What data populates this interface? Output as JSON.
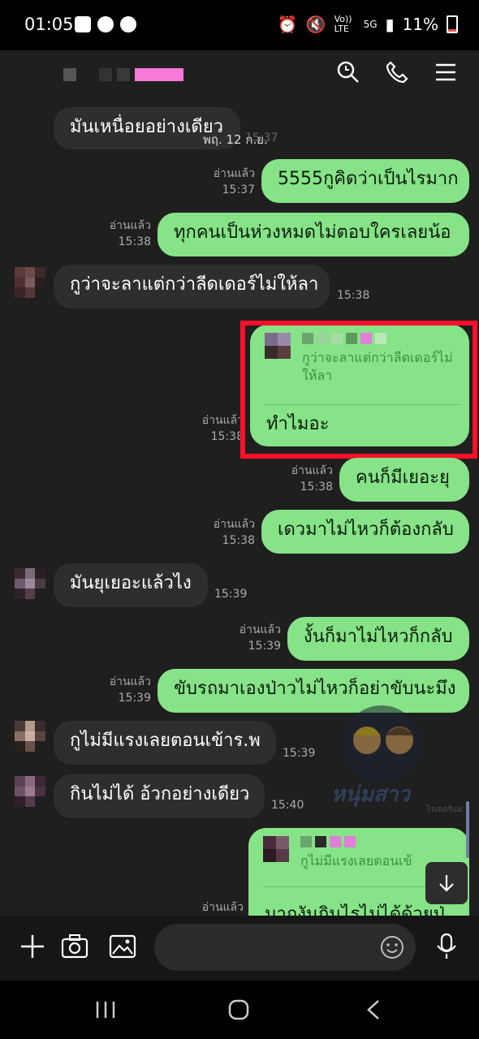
{
  "status_bar": {
    "time": "01:05",
    "network": "Vo)) LTE",
    "network_type": "5G",
    "battery": "11%"
  },
  "header": {
    "icons": [
      "search-icon",
      "phone-icon",
      "menu-icon"
    ]
  },
  "date_chip": "พฤ. 12 ก.ย.",
  "messages": [
    {
      "id": "m1",
      "side": "in",
      "text": "มันเหนื่อยอย่างเดียว",
      "time": "15:37"
    },
    {
      "id": "m2",
      "side": "out",
      "text": "5555กูคิดว่าเป็นไรมาก",
      "read": "อ่านแล้ว",
      "time": "15:37"
    },
    {
      "id": "m3",
      "side": "out",
      "text": "ทุกคนเป็นห่วงหมดไม่ตอบใครเลยน้อ",
      "read": "อ่านแล้ว",
      "time": "15:38"
    },
    {
      "id": "m4",
      "side": "in",
      "text": "กูว่าจะลาแต่กว่าลีดเดอร์ไม่ให้ลา",
      "time": "15:38"
    },
    {
      "id": "m5",
      "side": "out",
      "quote": "กูว่าจะลาแต่กว่าลีดเดอร์ไม่ให้ลา",
      "text": "ทำไมอะ",
      "read": "อ่านแล้ว",
      "time": "15:38"
    },
    {
      "id": "m6",
      "side": "out",
      "text": "คนก็มีเยอะยุ",
      "read": "อ่านแล้ว",
      "time": "15:38"
    },
    {
      "id": "m7",
      "side": "out",
      "text": "เดวมาไม่ไหวก็ต้องกลับ",
      "read": "อ่านแล้ว",
      "time": "15:38"
    },
    {
      "id": "m8",
      "side": "in",
      "text": "มันยุเยอะแล้วไง",
      "time": "15:39"
    },
    {
      "id": "m9",
      "side": "out",
      "text": "งั้นก็มาไม่ไหวก็กลับ",
      "read": "อ่านแล้ว",
      "time": "15:39"
    },
    {
      "id": "m10",
      "side": "out",
      "text": "ขับรถมาเองป่าวไม่ไหวก็อย่าขับนะมึง",
      "read": "อ่านแล้ว",
      "time": "15:39"
    },
    {
      "id": "m11",
      "side": "in",
      "text": "กูไม่มีแรงเลยตอนเข้าร.พ",
      "time": "15:39"
    },
    {
      "id": "m12",
      "side": "in",
      "text": "กินไม่ได้ อ้วกอย่างเดียว",
      "time": "15:40"
    },
    {
      "id": "m13",
      "side": "out",
      "quote": "กูไม่มีแรงเลยตอนเข้",
      "text": "มาถงันกินไรไม่ได้ด้วยป่",
      "read": "อ่านแล้ว"
    }
  ],
  "watermark_text": "หนุ่มสาว",
  "watermark_sub": "ไรเดอร์แมน",
  "colors": {
    "outgoing": "#86e387",
    "incoming": "#2e2e2e",
    "background": "#1f1f1f",
    "highlight": "#ff0f2a"
  }
}
